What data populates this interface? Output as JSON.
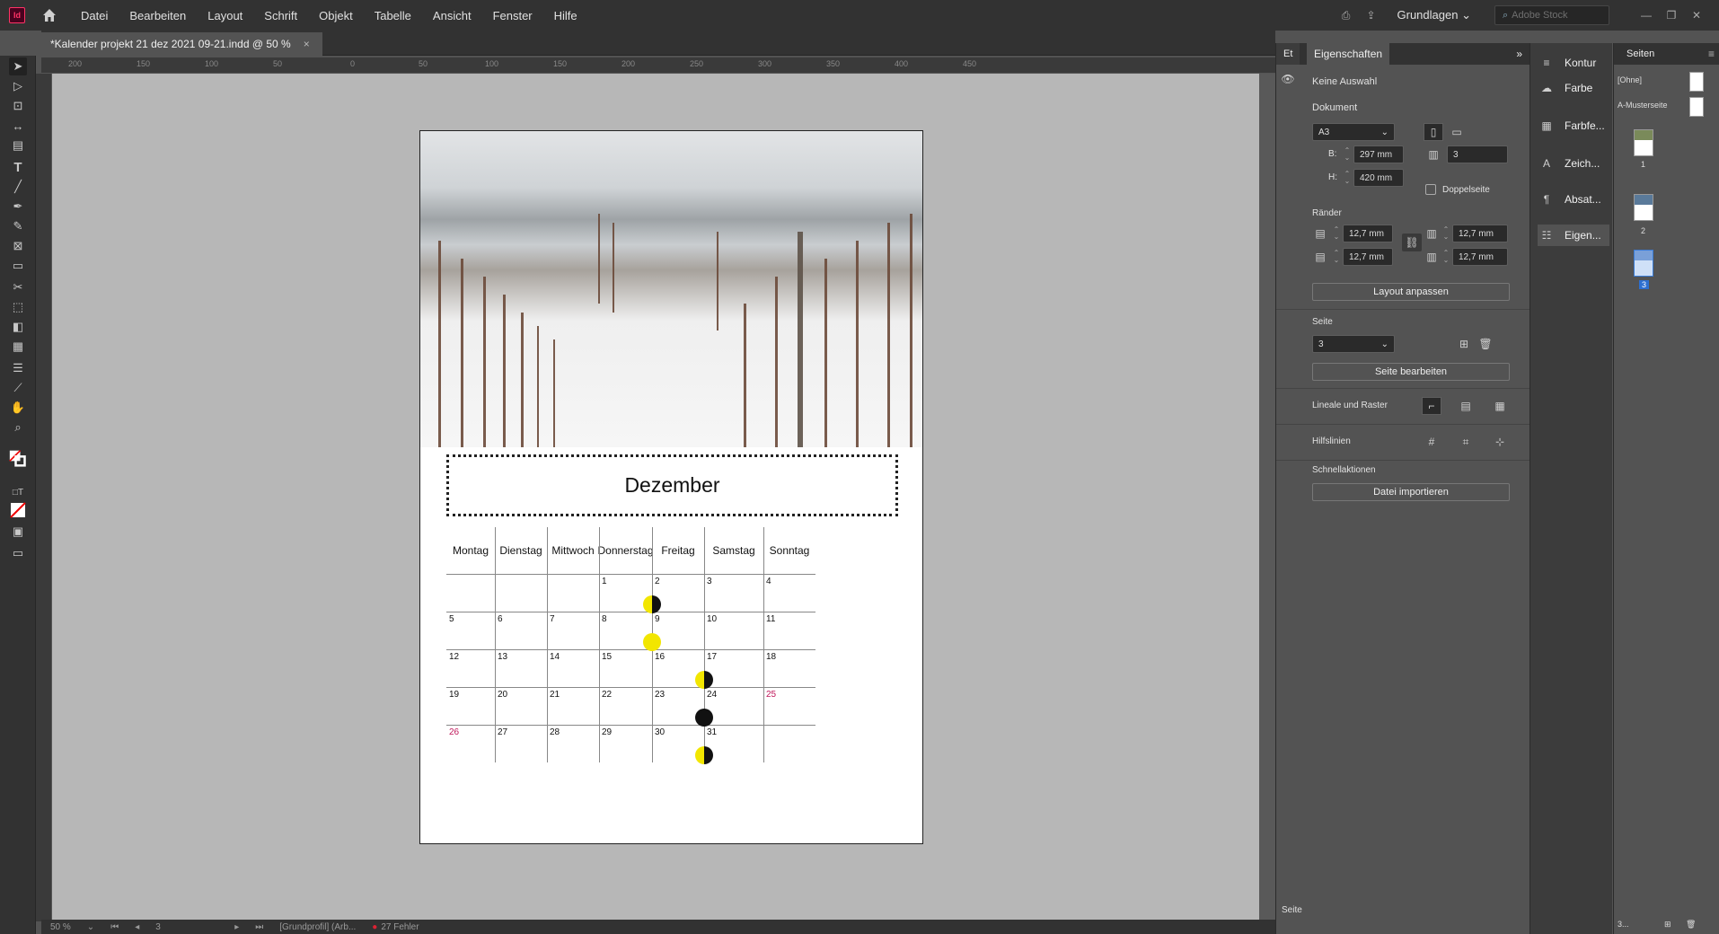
{
  "app": {
    "logo": "Id"
  },
  "menu": [
    "Datei",
    "Bearbeiten",
    "Layout",
    "Schrift",
    "Objekt",
    "Tabelle",
    "Ansicht",
    "Fenster",
    "Hilfe"
  ],
  "topbar": {
    "workspace": "Grundlagen",
    "stock_placeholder": "Adobe Stock"
  },
  "tab": {
    "title": "*Kalender projekt 21 dez 2021 09-21.indd @ 50 %",
    "close": "×"
  },
  "ruler_ticks": [
    "200",
    "150",
    "100",
    "50",
    "0",
    "50",
    "100",
    "150",
    "200",
    "250",
    "300",
    "350",
    "400",
    "450"
  ],
  "status": {
    "zoom": "50 %",
    "page": "3",
    "profile": "[Grundprofil] (Arb...",
    "errors": "27 Fehler"
  },
  "calendar": {
    "month": "Dezember",
    "weekdays": [
      "Montag",
      "Dienstag",
      "Mittwoch",
      "Donnerstag",
      "Freitag",
      "Samstag",
      "Sonntag"
    ],
    "weeks": [
      [
        "",
        "",
        "",
        "1",
        "2",
        "3",
        "4"
      ],
      [
        "5",
        "6",
        "7",
        "8",
        "9",
        "10",
        "11"
      ],
      [
        "12",
        "13",
        "14",
        "15",
        "16",
        "17",
        "18"
      ],
      [
        "19",
        "20",
        "21",
        "22",
        "23",
        "24",
        "25"
      ],
      [
        "26",
        "27",
        "28",
        "29",
        "30",
        "31",
        ""
      ]
    ],
    "red_days": [
      "25",
      "26"
    ],
    "holiday_color": "#c0185b",
    "moon_colors": {
      "yellow": "#f2e600",
      "black": "#111111"
    },
    "moons": [
      {
        "row": 0,
        "col": 3,
        "phase": "first-quarter"
      },
      {
        "row": 1,
        "col": 3,
        "phase": "full"
      },
      {
        "row": 2,
        "col": 4,
        "phase": "last-quarter"
      },
      {
        "row": 3,
        "col": 4,
        "phase": "new"
      },
      {
        "row": 4,
        "col": 4,
        "phase": "first-quarter"
      }
    ]
  },
  "properties": {
    "tab_label": "Eigenschaften",
    "collapsed_tab": "Et",
    "selection": "Keine Auswahl",
    "document_heading": "Dokument",
    "format": "A3",
    "width_label": "B:",
    "width": "297 mm",
    "height_label": "H:",
    "height": "420 mm",
    "pages_count": "3",
    "facing_pages": "Doppelseite",
    "margins_heading": "Ränder",
    "margin_top": "12,7 mm",
    "margin_bottom": "12,7 mm",
    "margin_left": "12,7 mm",
    "margin_right": "12,7 mm",
    "adjust_layout": "Layout anpassen",
    "page_heading": "Seite",
    "page_value": "3",
    "edit_page": "Seite bearbeiten",
    "rulers_grids": "Lineale und Raster",
    "guides": "Hilfslinien",
    "quick_actions": "Schnellaktionen",
    "import_file": "Datei importieren",
    "footer_label": "Seite"
  },
  "side_panels": [
    {
      "label": "Kontur",
      "icon": "stroke-icon"
    },
    {
      "label": "Farbe",
      "icon": "color-icon"
    },
    {
      "label": "Farbfe...",
      "icon": "swatches-icon"
    },
    {
      "label": "Zeich...",
      "icon": "character-icon"
    },
    {
      "label": "Absat...",
      "icon": "paragraph-icon"
    },
    {
      "label": "Eigen...",
      "icon": "properties-icon"
    }
  ],
  "pages_panel": {
    "title": "Seiten",
    "none": "[Ohne]",
    "master": "A-Musterseite",
    "page_numbers": [
      "1",
      "2",
      "3"
    ],
    "footer": "3..."
  }
}
